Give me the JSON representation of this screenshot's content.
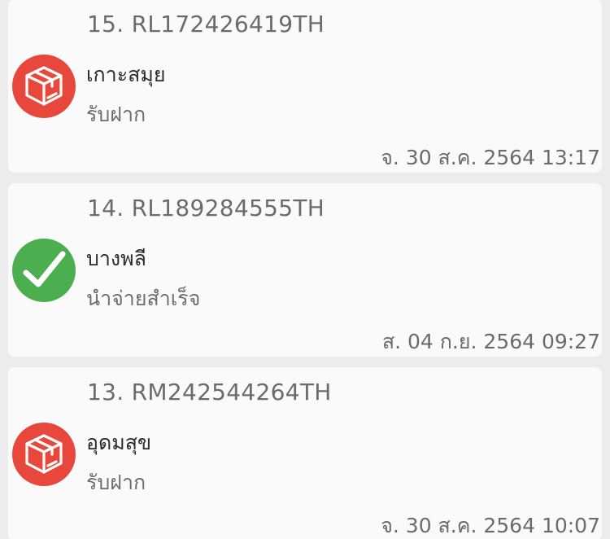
{
  "items": [
    {
      "tracking": "15. RL172426419TH",
      "location": "เกาะสมุย",
      "status": "รับฝาก",
      "datetime": "จ. 30 ส.ค. 2564 13:17",
      "icon": "package-icon",
      "icon_color": "#e8483c"
    },
    {
      "tracking": "14. RL189284555TH",
      "location": "บางพลี",
      "status": "นำจ่ายสำเร็จ",
      "datetime": "ส. 04 ก.ย. 2564 09:27",
      "icon": "checkmark-icon",
      "icon_color": "#4caf4f"
    },
    {
      "tracking": "13. RM242544264TH",
      "location": "อุดมสุข",
      "status": "รับฝาก",
      "datetime": "จ. 30 ส.ค. 2564 10:07",
      "icon": "package-icon",
      "icon_color": "#e8483c"
    }
  ]
}
